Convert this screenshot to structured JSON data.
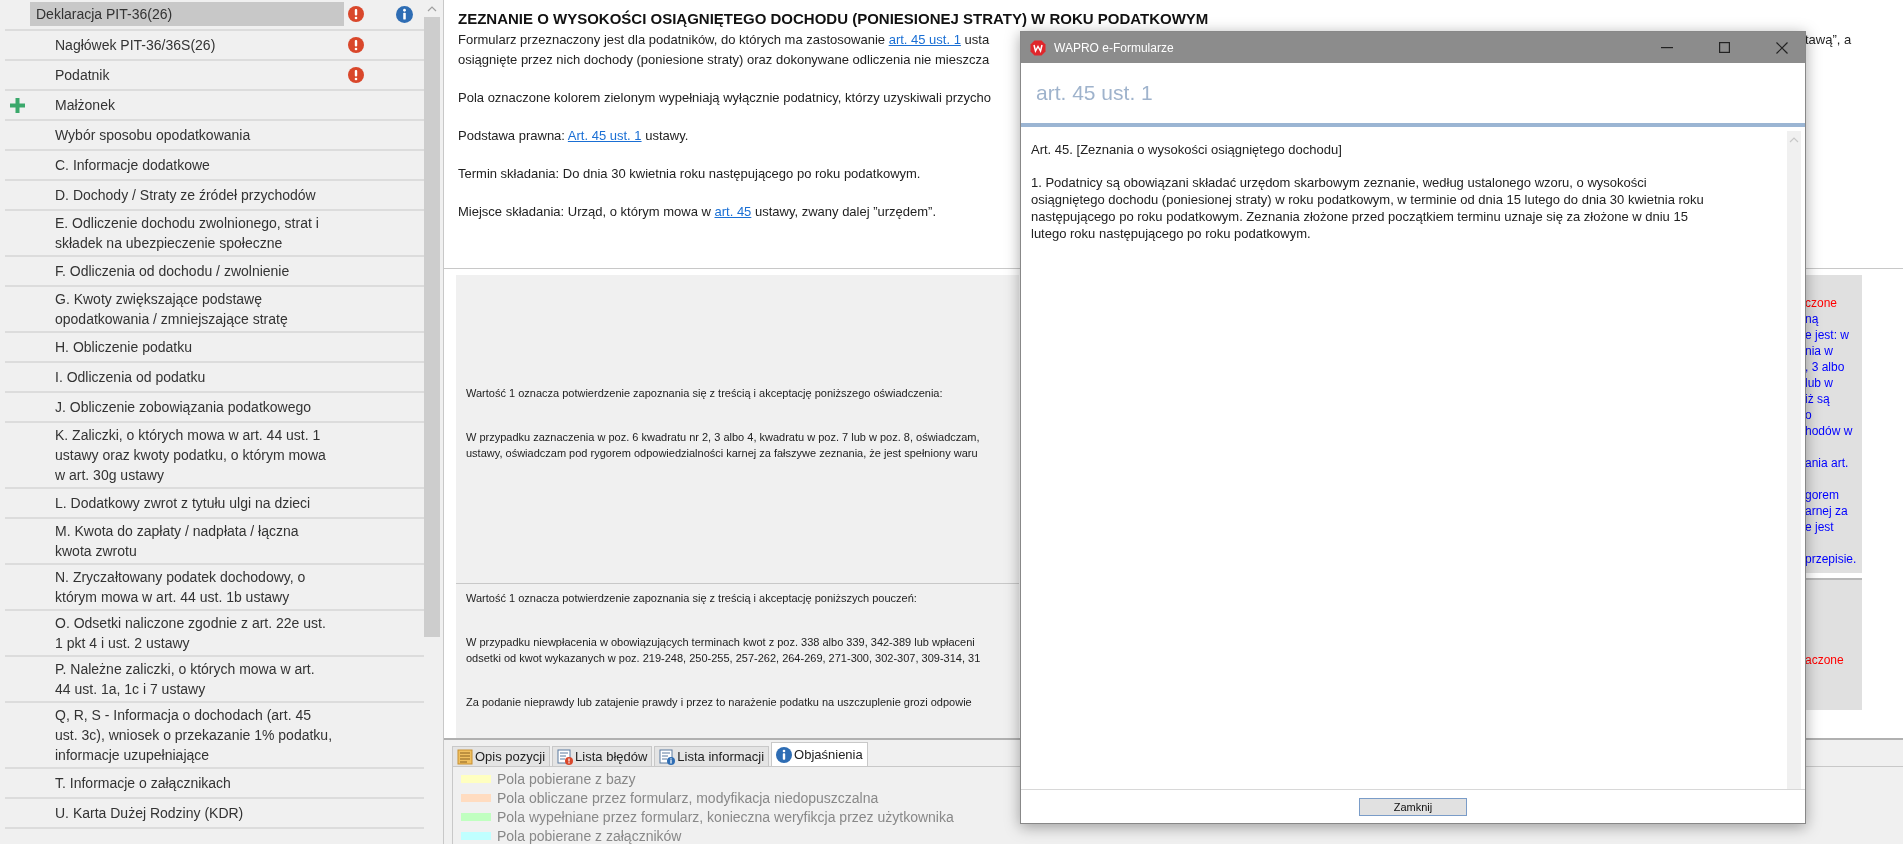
{
  "sidebar": {
    "items": [
      {
        "label": "Deklaracja PIT-36(26)",
        "selected": true,
        "error": true,
        "info": true,
        "add": false,
        "children": [
          {
            "label": "Nagłówek PIT-36/36S(26)",
            "selected": false,
            "error": true,
            "info": false,
            "add": false
          },
          {
            "label": "Podatnik",
            "selected": false,
            "error": true,
            "info": false,
            "add": false
          },
          {
            "label": "Małżonek",
            "selected": false,
            "error": false,
            "info": false,
            "add": true
          },
          {
            "label": "Wybór sposobu opodatkowania",
            "selected": false,
            "error": false,
            "info": false,
            "add": false
          },
          {
            "label": "C. Informacje dodatkowe",
            "selected": false,
            "error": false,
            "info": false,
            "add": false
          },
          {
            "label": "D. Dochody / Straty ze źródeł przychodów",
            "selected": false,
            "error": false,
            "info": false,
            "add": false
          },
          {
            "label": "E. Odliczenie dochodu zwolnionego, strat i składek na ubezpieczenie społeczne",
            "selected": false,
            "error": false,
            "info": false,
            "add": false
          },
          {
            "label": "F. Odliczenia od dochodu / zwolnienie",
            "selected": false,
            "error": false,
            "info": false,
            "add": false
          },
          {
            "label": "G. Kwoty zwiększające podstawę opodatkowania / zmniejszające stratę",
            "selected": false,
            "error": false,
            "info": false,
            "add": false
          },
          {
            "label": "H. Obliczenie podatku",
            "selected": false,
            "error": false,
            "info": false,
            "add": false
          },
          {
            "label": "I. Odliczenia od podatku",
            "selected": false,
            "error": false,
            "info": false,
            "add": false
          },
          {
            "label": "J. Obliczenie zobowiązania podatkowego",
            "selected": false,
            "error": false,
            "info": false,
            "add": false
          },
          {
            "label": "K. Zaliczki, o których mowa w art. 44 ust. 1 ustawy oraz kwoty podatku, o którym mowa w art. 30g ustawy",
            "selected": false,
            "error": false,
            "info": false,
            "add": false
          },
          {
            "label": "L. Dodatkowy zwrot z tytułu ulgi na dzieci",
            "selected": false,
            "error": false,
            "info": false,
            "add": false
          },
          {
            "label": "M. Kwota do zapłaty / nadpłata / łączna kwota zwrotu",
            "selected": false,
            "error": false,
            "info": false,
            "add": false
          },
          {
            "label": "N. Zryczałtowany podatek dochodowy, o którym mowa w art. 44 ust. 1b ustawy",
            "selected": false,
            "error": false,
            "info": false,
            "add": false
          },
          {
            "label": "O. Odsetki naliczone zgodnie z art. 22e ust. 1 pkt 4 i ust. 2 ustawy",
            "selected": false,
            "error": false,
            "info": false,
            "add": false
          },
          {
            "label": "P. Należne zaliczki, o których mowa w art. 44 ust. 1a, 1c i 7 ustawy",
            "selected": false,
            "error": false,
            "info": false,
            "add": false
          },
          {
            "label": "Q, R, S - Informacja o dochodach (art. 45 ust. 3c), wniosek o przekazanie 1% podatku, informacje uzupełniające",
            "selected": false,
            "error": false,
            "info": false,
            "add": false
          },
          {
            "label": "T. Informacje o załącznikach",
            "selected": false,
            "error": false,
            "info": false,
            "add": false
          },
          {
            "label": "U. Karta Dużej Rodziny (KDR)",
            "selected": false,
            "error": false,
            "info": false,
            "add": false
          }
        ]
      }
    ]
  },
  "header": {
    "title": "ZEZNANIE O WYSOKOŚCI OSIĄGNIĘTEGO DOCHODU (PONIESIONEJ STRATY) W ROKU PODATKOWYM",
    "paragraphs": [
      {
        "lines": [
          [
            {
              "text": "Formularz przeznaczony jest dla podatników, do których ma zastosowanie ",
              "link": false
            },
            {
              "text": "art. 45 ust. 1",
              "link": true
            },
            {
              "text": " usta",
              "link": false
            }
          ],
          [
            {
              "text": "osiągnięte przez nich dochody (poniesione straty) oraz dokonywane odliczenia nie mieszcza",
              "link": false
            }
          ]
        ],
        "tail": "tawą”, a"
      },
      {
        "lines": [
          [
            {
              "text": "Pola oznaczone kolorem zielonym wypełniają wyłącznie podatnicy, którzy uzyskiwali przycho",
              "link": false
            }
          ]
        ]
      },
      {
        "lines": [
          [
            {
              "text": "Podstawa prawna: ",
              "link": false
            },
            {
              "text": "Art. 45 ust. 1",
              "link": true
            },
            {
              "text": " ustawy.",
              "link": false
            }
          ]
        ]
      },
      {
        "lines": [
          [
            {
              "text": "Termin składania: Do dnia 30 kwietnia roku następującego po roku podatkowym.",
              "link": false
            }
          ]
        ]
      },
      {
        "lines": [
          [
            {
              "text": "Miejsce składania: Urząd, o którym mowa w ",
              "link": false
            },
            {
              "text": "art. 45",
              "link": true
            },
            {
              "text": " ustawy, zwany dalej ”urzędem”.",
              "link": false
            }
          ]
        ]
      }
    ]
  },
  "form": {
    "sections": [
      {
        "texts": [
          [
            "Wartość 1 oznacza potwierdzenie zapoznania się z treścią i akceptację poniższego oświadczenia:"
          ],
          [
            "W przypadku zaznaczenia w poz. 6 kwadratu nr 2, 3 albo 4, kwadratu w poz. 7 lub w poz. 8, oświadczam,",
            "ustawy, oświadczam pod rygorem odpowiedzialności karnej za fałszywe zeznania, że jest spełniony waru"
          ]
        ]
      },
      {
        "texts": [
          [
            "Wartość 1 oznacza potwierdzenie zapoznania się z treścią i akceptację poniższych pouczeń:"
          ],
          [
            "W przypadku niewpłacenia w obowiązujących terminach kwot z poz. 338 albo 339, 342-389 lub wpłaceni",
            "odsetki od kwot wykazanych w poz. 219-248, 250-255, 257-262, 264-269, 271-300, 302-307, 309-314, 31"
          ],
          [
            "Za podanie nieprawdy lub zatajenie prawdy i przez to narażenie podatku na uszczuplenie grozi odpowie"
          ]
        ]
      }
    ],
    "side_notes": [
      {
        "color": "#ff0000",
        "lines": [
          "czone"
        ]
      },
      {
        "color": "#0000ff",
        "lines": [
          "ną",
          "e jest: w",
          "nia w",
          ", 3 albo",
          "lub w",
          "iż są",
          "o",
          "hodów w"
        ]
      },
      {
        "color": "#0000ff",
        "lines": [
          "ania art."
        ]
      },
      {
        "color": "#0000ff",
        "lines": [
          "gorem",
          "arnej za",
          "e jest"
        ]
      },
      {
        "color": "#0000ff",
        "lines": [
          "przepisie."
        ]
      }
    ],
    "side_box": {
      "color": "#ff0000",
      "text": "aczone"
    }
  },
  "bottom_panel": {
    "tabs": [
      {
        "label": "Opis pozycji",
        "kind": "document",
        "selected": false
      },
      {
        "label": "Lista błędów",
        "kind": "errors",
        "selected": false
      },
      {
        "label": "Lista informacji",
        "kind": "infos",
        "selected": false
      },
      {
        "label": "Objaśnienia",
        "kind": "info",
        "selected": true
      }
    ],
    "legend": [
      {
        "label": "Pola pobierane z bazy",
        "color": "#ffffc0"
      },
      {
        "label": "Pola obliczane przez formularz, modyfikacja niedopuszczalna",
        "color": "#ffdcc0"
      },
      {
        "label": "Pola wypełniane przez formularz, konieczna weryfikcja przez użytkownika",
        "color": "#c0ffc0"
      },
      {
        "label": "Pola pobierane z załączników",
        "color": "#c0ffff"
      }
    ]
  },
  "dialog": {
    "title": "WAPRO e-Formularze",
    "heading": "art. 45 ust. 1",
    "paragraphs": [
      "Art. 45. [Zeznania o wysokości osiągniętego dochodu]",
      "1. Podatnicy są obowiązani składać urzędom skarbowym zeznanie, według ustalonego wzoru, o wysokości osiągniętego dochodu (poniesionej straty) w roku podatkowym, w terminie od dnia 15 lutego do dnia 30 kwietnia roku następującego po roku podatkowym. Zeznania złożone przed początkiem terminu uznaje się za złożone w dniu 15 lutego roku następującego po roku podatkowym."
    ],
    "button": "Zamknij"
  }
}
